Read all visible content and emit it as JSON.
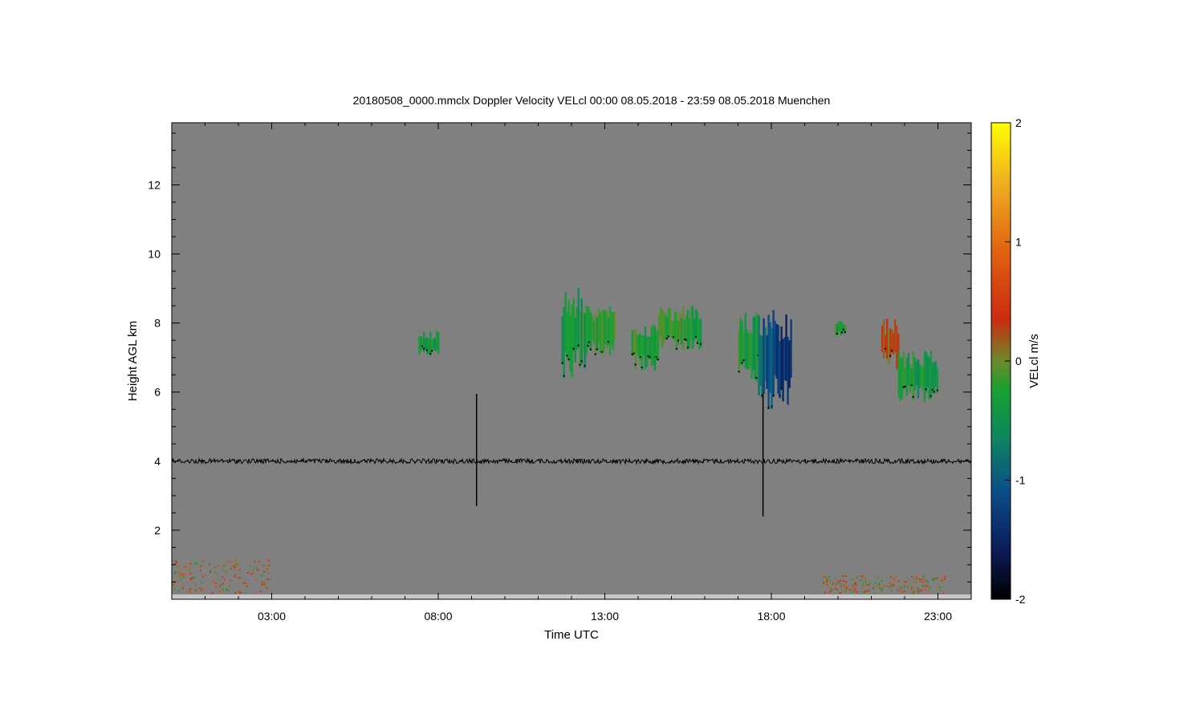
{
  "chart_data": {
    "type": "heatmap",
    "title": "20180508_0000.mmclx Doppler Velocity VELcl   00:00 08.05.2018 - 23:59 08.05.2018 Muenchen",
    "xlabel": "Time UTC",
    "ylabel": "Height AGL km",
    "colorbar_label": "VELcl m/s",
    "xlim_hours": [
      0,
      24
    ],
    "ylim_km": [
      0,
      13.8
    ],
    "x_ticks": [
      {
        "value": 3,
        "label": "03:00"
      },
      {
        "value": 8,
        "label": "08:00"
      },
      {
        "value": 13,
        "label": "13:00"
      },
      {
        "value": 18,
        "label": "18:00"
      },
      {
        "value": 23,
        "label": "23:00"
      }
    ],
    "y_ticks": [
      {
        "value": 2,
        "label": "2"
      },
      {
        "value": 4,
        "label": "4"
      },
      {
        "value": 6,
        "label": "6"
      },
      {
        "value": 8,
        "label": "8"
      },
      {
        "value": 10,
        "label": "10"
      },
      {
        "value": 12,
        "label": "12"
      }
    ],
    "colorbar": {
      "range": [
        -2,
        2
      ],
      "ticks": [
        {
          "value": 2,
          "label": "2"
        },
        {
          "value": 1,
          "label": "1"
        },
        {
          "value": 0,
          "label": "0"
        },
        {
          "value": -1,
          "label": "-1"
        },
        {
          "value": -2,
          "label": "-2"
        }
      ],
      "stops": [
        {
          "value": -2,
          "color": "#000000"
        },
        {
          "value": -1.6,
          "color": "#0a1a55"
        },
        {
          "value": -1.1,
          "color": "#0b4d8a"
        },
        {
          "value": -0.6,
          "color": "#0e8a5a"
        },
        {
          "value": -0.25,
          "color": "#18a030"
        },
        {
          "value": 0,
          "color": "#6a8a2a"
        },
        {
          "value": 0.35,
          "color": "#cc2a10"
        },
        {
          "value": 0.9,
          "color": "#e06010"
        },
        {
          "value": 1.5,
          "color": "#f0b020"
        },
        {
          "value": 2,
          "color": "#ffff00"
        }
      ]
    },
    "background_color": "#808080",
    "reference_line_km": 4,
    "spikes": [
      {
        "time_h": 9.15,
        "top_km": 5.95,
        "bottom_km": 2.7
      },
      {
        "time_h": 17.75,
        "top_km": 5.95,
        "bottom_km": 2.4
      }
    ],
    "cloud_patches": [
      {
        "t_start": 7.4,
        "t_end": 8.0,
        "base_km": 7.0,
        "top_km": 7.8,
        "velocity": -0.3
      },
      {
        "t_start": 11.7,
        "t_end": 12.5,
        "base_km": 6.4,
        "top_km": 9.1,
        "velocity": -0.35
      },
      {
        "t_start": 12.5,
        "t_end": 13.3,
        "base_km": 7.0,
        "top_km": 8.5,
        "velocity": -0.25
      },
      {
        "t_start": 13.8,
        "t_end": 14.6,
        "base_km": 6.6,
        "top_km": 8.0,
        "velocity": -0.3
      },
      {
        "t_start": 14.6,
        "t_end": 15.9,
        "base_km": 7.2,
        "top_km": 8.5,
        "velocity": -0.25
      },
      {
        "t_start": 17.0,
        "t_end": 17.6,
        "base_km": 6.3,
        "top_km": 8.4,
        "velocity": -0.35
      },
      {
        "t_start": 17.6,
        "t_end": 18.6,
        "base_km": 5.5,
        "top_km": 8.4,
        "velocity": -0.9
      },
      {
        "t_start": 19.9,
        "t_end": 20.2,
        "base_km": 7.6,
        "top_km": 8.1,
        "velocity": -0.3
      },
      {
        "t_start": 21.3,
        "t_end": 21.8,
        "base_km": 6.6,
        "top_km": 8.2,
        "velocity": 0.15
      },
      {
        "t_start": 21.8,
        "t_end": 23.0,
        "base_km": 5.7,
        "top_km": 7.2,
        "velocity": -0.35
      }
    ],
    "low_level_echo": [
      {
        "t_start": 0.0,
        "t_end": 3.0,
        "base_km": 0.2,
        "top_km": 1.2,
        "velocity": 0.3
      },
      {
        "t_start": 19.5,
        "t_end": 23.2,
        "base_km": 0.2,
        "top_km": 0.7,
        "velocity": 0.2
      }
    ]
  }
}
